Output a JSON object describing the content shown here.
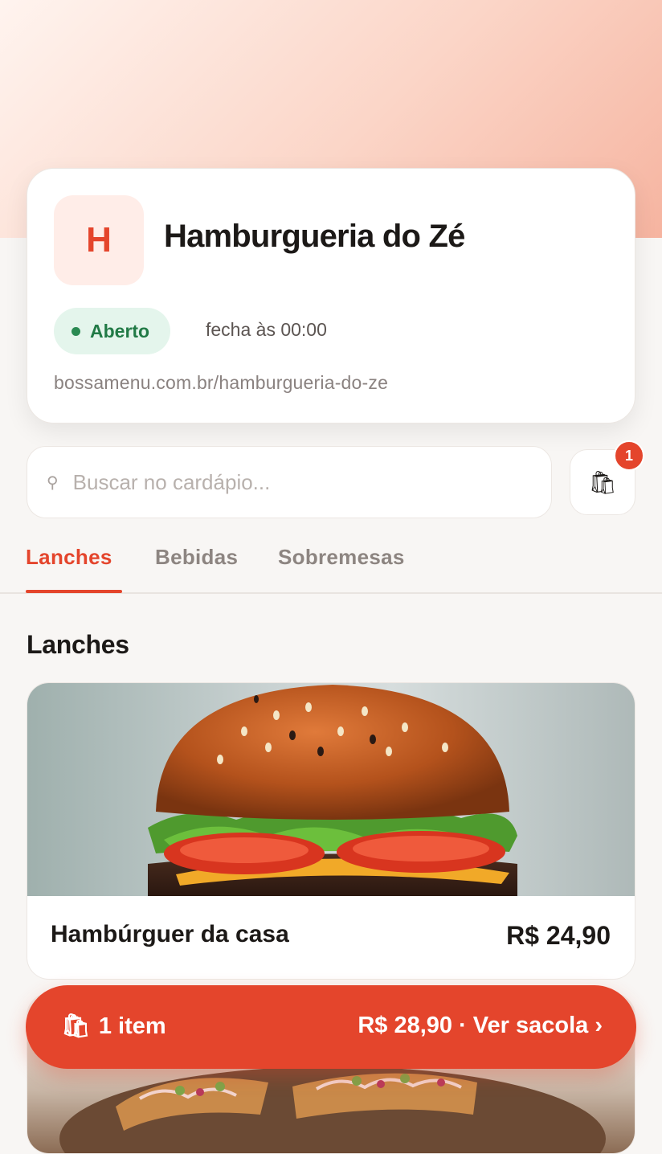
{
  "store": {
    "logo_letter": "H",
    "name": "Hamburgueria do Zé",
    "status": "Aberto",
    "closing": "fecha às 00:00",
    "url": "bossamenu.com.br/hamburgueria-do-ze"
  },
  "search": {
    "icon": "search-icon",
    "placeholder": "Buscar no cardápio..."
  },
  "bag": {
    "icon": "shopping-bag-icon",
    "glyph": "🛍",
    "badge_count": "1"
  },
  "tabs": [
    {
      "label": "Lanches",
      "active": true
    },
    {
      "label": "Bebidas",
      "active": false
    },
    {
      "label": "Sobremesas",
      "active": false
    }
  ],
  "section": {
    "title": "Lanches"
  },
  "products": [
    {
      "name": "Hambúrguer da casa",
      "price": "R$ 24,90"
    }
  ],
  "cart_bar": {
    "icon_glyph": "🛍",
    "count_label": "1 item",
    "total_label": "R$ 28,90 · Ver sacola ›"
  },
  "colors": {
    "accent": "#e4452c",
    "open_status_bg": "#e4f5ec",
    "open_status_text": "#217a46",
    "background": "#f8f6f4"
  }
}
